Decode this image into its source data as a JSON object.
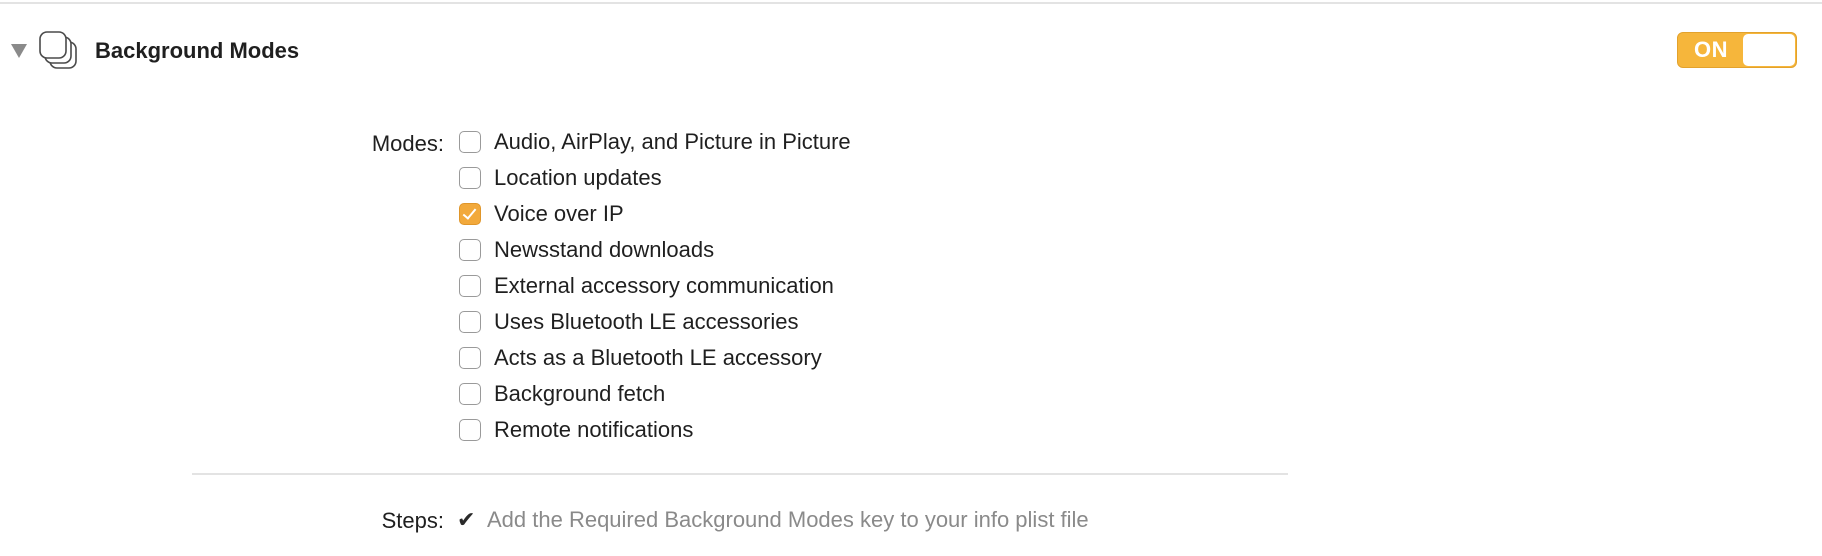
{
  "section": {
    "title": "Background Modes",
    "icon": "background-modes-stack-icon",
    "expanded": true
  },
  "toggle": {
    "label": "ON",
    "state": true,
    "accent_color": "#f6b63b"
  },
  "modes": {
    "label": "Modes:",
    "items": [
      {
        "label": "Audio, AirPlay, and Picture in Picture",
        "checked": false
      },
      {
        "label": "Location updates",
        "checked": false
      },
      {
        "label": "Voice over IP",
        "checked": true
      },
      {
        "label": "Newsstand downloads",
        "checked": false
      },
      {
        "label": "External accessory communication",
        "checked": false
      },
      {
        "label": "Uses Bluetooth LE accessories",
        "checked": false
      },
      {
        "label": "Acts as a Bluetooth LE accessory",
        "checked": false
      },
      {
        "label": "Background fetch",
        "checked": false
      },
      {
        "label": "Remote notifications",
        "checked": false
      }
    ]
  },
  "steps": {
    "label": "Steps:",
    "items": [
      {
        "check": "✔",
        "text": "Add the Required Background Modes key to your info plist file"
      }
    ]
  }
}
